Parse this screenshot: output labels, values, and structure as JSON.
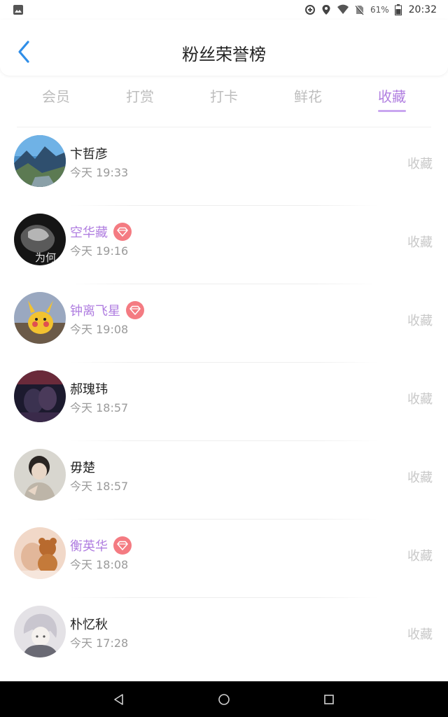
{
  "status_bar": {
    "battery": "61%",
    "time": "20:32",
    "icons": [
      "image-icon",
      "data-saver-icon",
      "location-icon",
      "wifi-icon",
      "no-sim-icon",
      "battery-icon"
    ]
  },
  "header": {
    "title": "粉丝荣誉榜",
    "back_icon": "chevron-left-icon"
  },
  "tabs": [
    {
      "label": "会员",
      "active": false
    },
    {
      "label": "打赏",
      "active": false
    },
    {
      "label": "打卡",
      "active": false
    },
    {
      "label": "鲜花",
      "active": false
    },
    {
      "label": "收藏",
      "active": true
    }
  ],
  "fans": [
    {
      "name": "卞哲彦",
      "time": "今天 19:33",
      "vip": false,
      "action": "收藏"
    },
    {
      "name": "空华藏",
      "time": "今天 19:16",
      "vip": true,
      "action": "收藏",
      "avatar_text": "为何"
    },
    {
      "name": "钟离飞星",
      "time": "今天 19:08",
      "vip": true,
      "action": "收藏"
    },
    {
      "name": "郝瑰玮",
      "time": "今天 18:57",
      "vip": false,
      "action": "收藏"
    },
    {
      "name": "毋楚",
      "time": "今天 18:57",
      "vip": false,
      "action": "收藏"
    },
    {
      "name": "衡英华",
      "time": "今天 18:08",
      "vip": true,
      "action": "收藏"
    },
    {
      "name": "朴忆秋",
      "time": "今天 17:28",
      "vip": false,
      "action": "收藏"
    }
  ],
  "colors": {
    "accent": "#b07ee0",
    "vip_badge": "#f47b82",
    "muted": "#9a9a9a",
    "tab_inactive": "#bdbdbd",
    "nav_bar": "#000000"
  },
  "nav_bar": {
    "icons": [
      "back-triangle-icon",
      "home-circle-icon",
      "recents-square-icon"
    ]
  }
}
